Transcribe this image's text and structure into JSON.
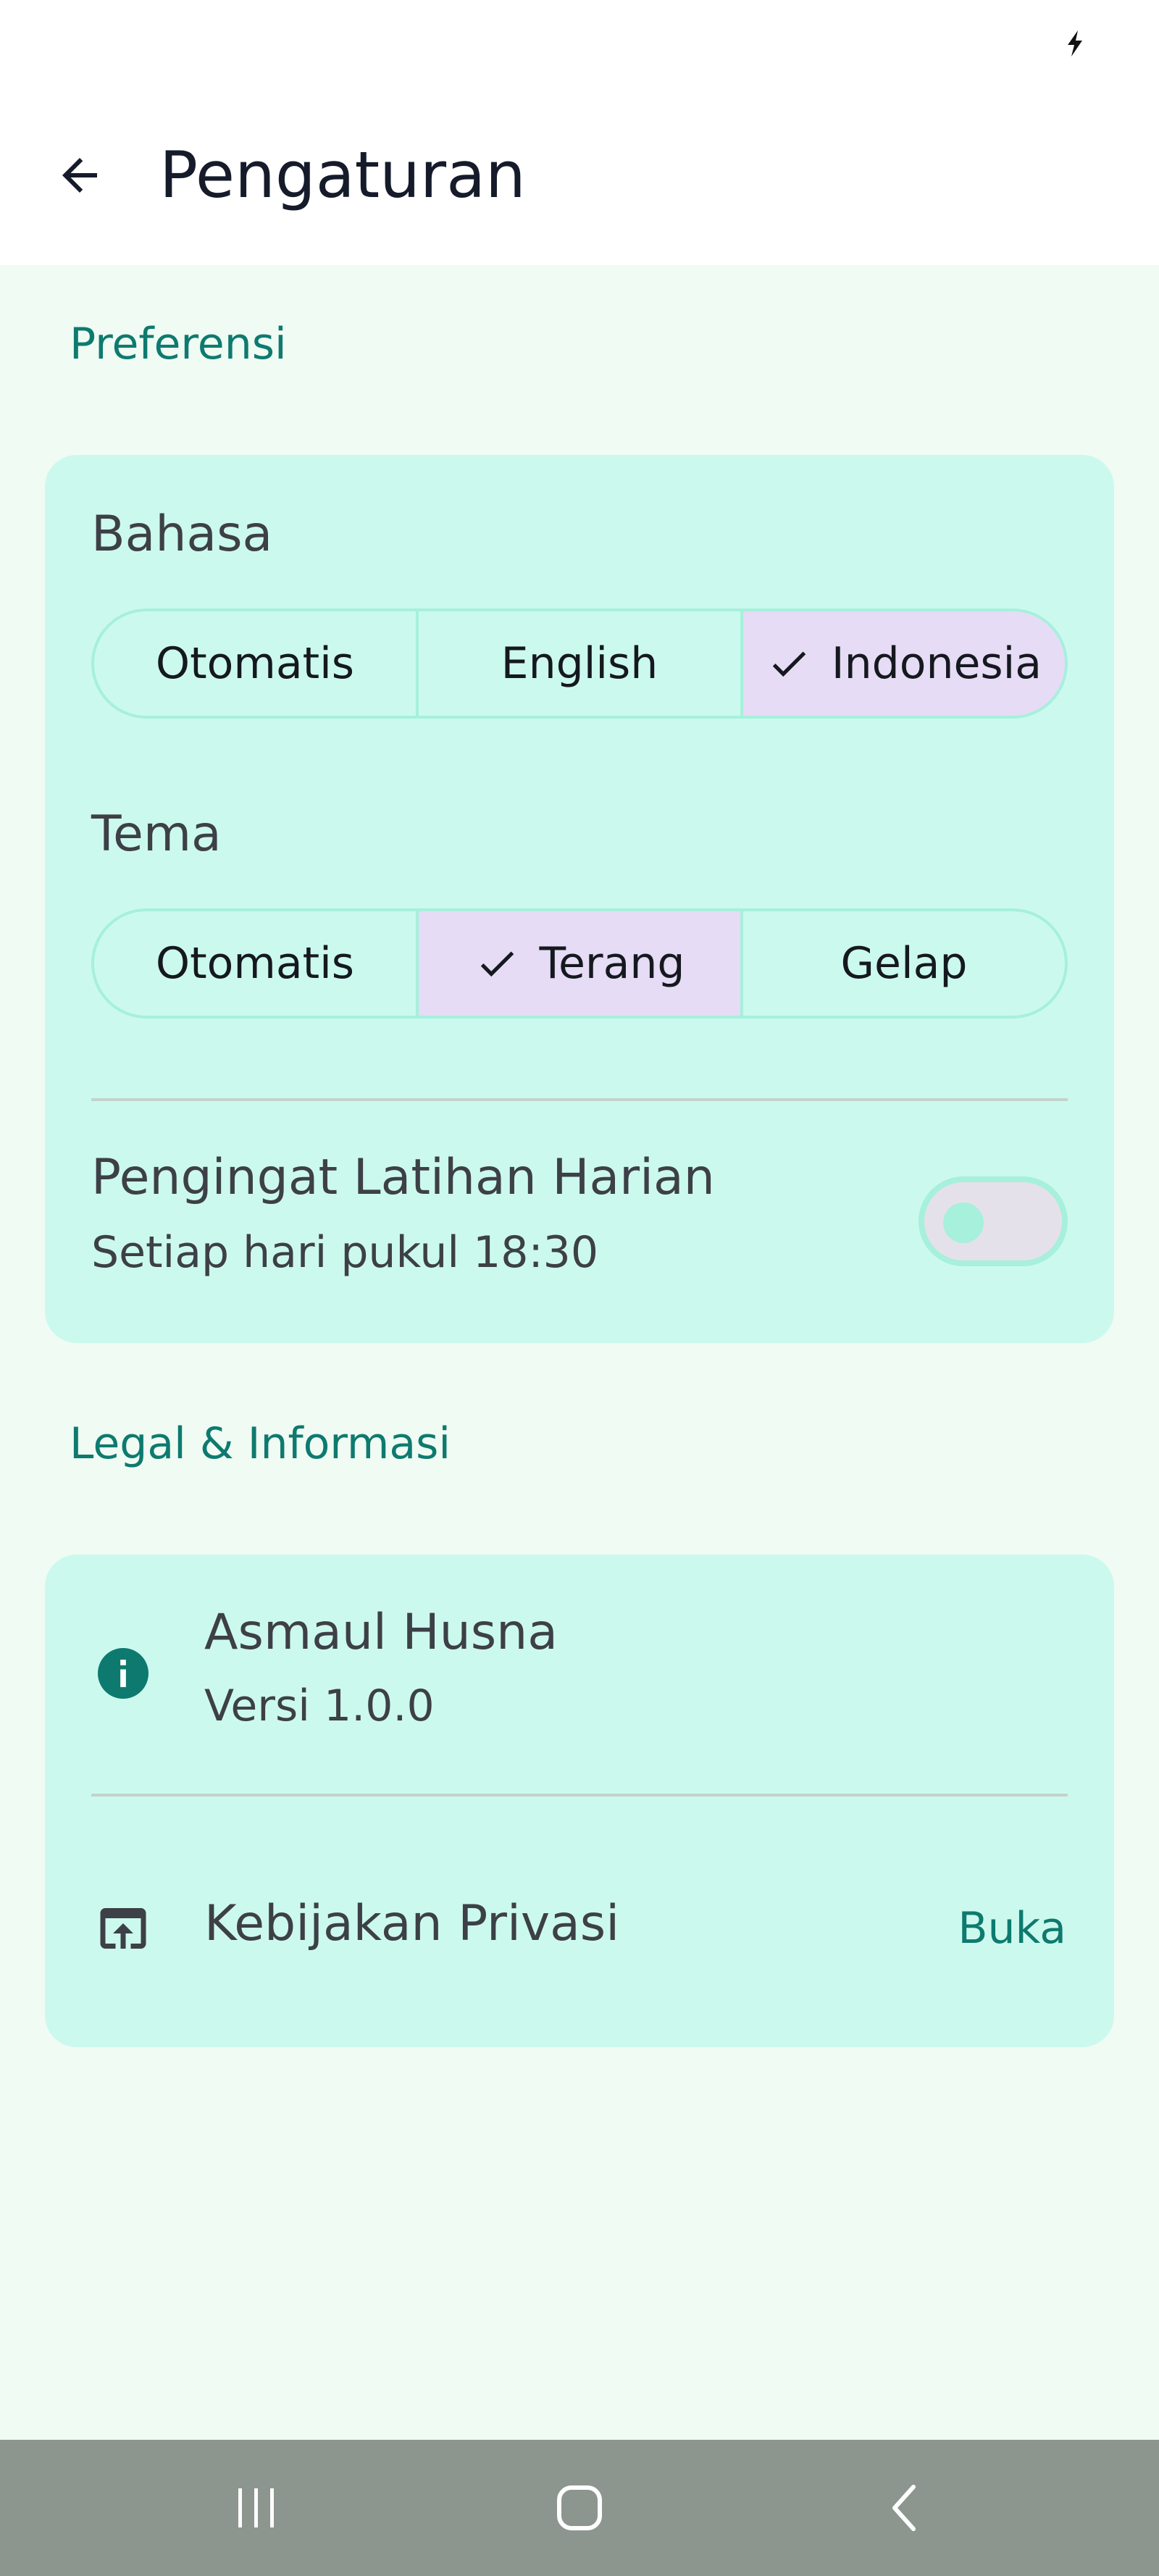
{
  "header": {
    "title": "Pengaturan"
  },
  "sections": {
    "preferences_title": "Preferensi",
    "legal_title": "Legal & Informasi"
  },
  "language": {
    "label": "Bahasa",
    "options": [
      "Otomatis",
      "English",
      "Indonesia"
    ],
    "selected": "Indonesia"
  },
  "theme": {
    "label": "Tema",
    "options": [
      "Otomatis",
      "Terang",
      "Gelap"
    ],
    "selected": "Terang"
  },
  "reminder": {
    "title": "Pengingat Latihan Harian",
    "subtitle": "Setiap hari pukul 18:30",
    "enabled": false
  },
  "app_info": {
    "name": "Asmaul Husna",
    "version": "Versi 1.0.0"
  },
  "privacy": {
    "label": "Kebijakan Privasi",
    "action": "Buka"
  },
  "icons": {
    "back": "arrow-left-icon",
    "check": "check-icon",
    "info": "info-icon",
    "open_in_new": "open-in-browser-icon",
    "status": "charging-icon",
    "nav": [
      "recent-apps-icon",
      "home-icon",
      "nav-back-icon"
    ]
  },
  "colors": {
    "background": "#effbf3",
    "card": "#ccf9ee",
    "accent": "#0e7a6f",
    "segment_selected": "#e6dcf5",
    "segment_border": "#a6f0dc",
    "nav_bar": "#8c958e"
  }
}
